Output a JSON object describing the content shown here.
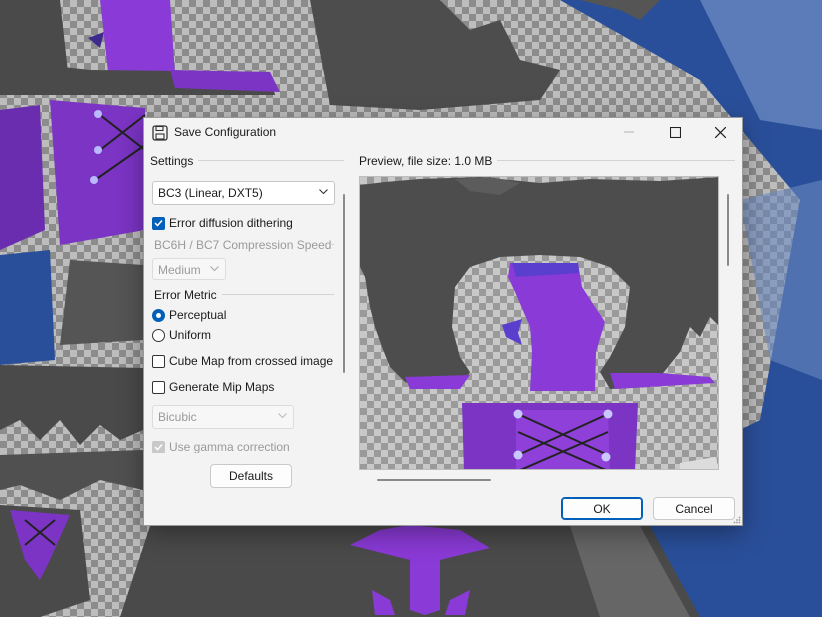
{
  "dialog": {
    "title": "Save Configuration",
    "icon": "floppy-disk-icon",
    "window_controls": [
      "minimize-icon",
      "maximize-icon",
      "close-icon"
    ]
  },
  "settings": {
    "group_label": "Settings",
    "format": {
      "value": "BC3 (Linear, DXT5)"
    },
    "error_diffusion": {
      "label": "Error diffusion dithering",
      "checked": true
    },
    "compression_speed": {
      "label": "BC6H / BC7 Compression Speed",
      "value": "Medium",
      "enabled": false
    },
    "error_metric": {
      "group_label": "Error Metric",
      "options": [
        {
          "label": "Perceptual",
          "selected": true
        },
        {
          "label": "Uniform",
          "selected": false
        }
      ]
    },
    "cube_map": {
      "label": "Cube Map from crossed image",
      "checked": false
    },
    "mip_maps": {
      "label": "Generate Mip Maps",
      "checked": false
    },
    "mip_filter": {
      "value": "Bicubic",
      "enabled": false
    },
    "gamma": {
      "label": "Use gamma correction",
      "checked": true,
      "enabled": false
    },
    "defaults_label": "Defaults"
  },
  "preview": {
    "label": "Preview, file size: 1.0 MB"
  },
  "buttons": {
    "ok": "OK",
    "cancel": "Cancel"
  },
  "colors": {
    "accent": "#005fb8",
    "texture_purple": "#8a3ad6",
    "texture_blue": "#2a4f9a",
    "texture_dark": "#4a4a4a"
  }
}
